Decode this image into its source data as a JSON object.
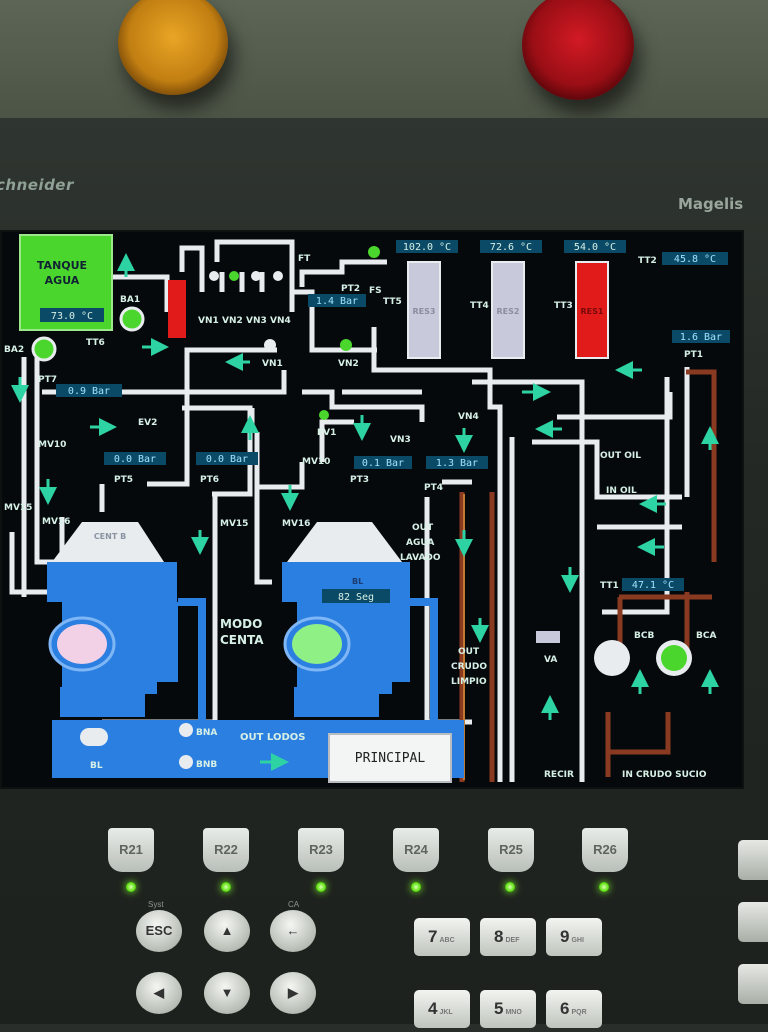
{
  "device": {
    "brand": "chneider",
    "model": "Magelis"
  },
  "tags": {
    "tank": [
      "TANQUE",
      "AGUA"
    ],
    "tank_temp": "73.0 °C",
    "ba1": "BA1",
    "ba2": "BA2",
    "tt6": "TT6",
    "pt7": "PT7",
    "pt7_val": "0.9 Bar",
    "vn1": "VN1",
    "vn2": "VN2",
    "vn3": "VN3",
    "vn4": "VN4",
    "ft": "FT",
    "pt2": "PT2",
    "pt2_val": "1.4 Bar",
    "fs": "FS",
    "tt5": "TT5",
    "res3_temp": "102.0 °C",
    "res2_temp": "72.6 °C",
    "res1_temp": "54.0 °C",
    "tt4": "TT4",
    "tt3": "TT3",
    "tt2": "TT2",
    "tt2_val": "45.8 °C",
    "pt1": "PT1",
    "pt1_val": "1.6 Bar",
    "res3": "RES3",
    "res2": "RES2",
    "res1": "RES1",
    "ev2": "EV2",
    "ev1": "EV1",
    "mv10": "MV10",
    "mv10b": "MV10",
    "pt5": "PT5",
    "pt5_val": "0.0 Bar",
    "pt6": "PT6",
    "pt6_val": "0.0 Bar",
    "pt3": "PT3",
    "pt3_val": "0.1 Bar",
    "pt4": "PT4",
    "pt4_val": "1.3 Bar",
    "mv15": "MV15",
    "mv16": "MV16",
    "mv15b": "MV15",
    "mv16b": "MV16",
    "cent_b": "CENT B",
    "bl_label": "BL",
    "timer": "82 Seg",
    "modo": [
      "MODO",
      "CENTA"
    ],
    "out_agua": [
      "OUT",
      "AGUA",
      "LAVADO"
    ],
    "out_crudo": [
      "OUT",
      "CRUDO",
      "LIMPIO"
    ],
    "out_oil": "OUT OIL",
    "in_oil": "IN OIL",
    "tt1": "TT1",
    "tt1_val": "47.1 °C",
    "bcb": "BCB",
    "bca": "BCA",
    "va": "VA",
    "bna": "BNA",
    "bnb": "BNB",
    "bl": "BL",
    "out_lodos": "OUT LODOS",
    "recir": "RECIR",
    "in_crudo_sucio": "IN CRUDO SUCIO",
    "principal": "PRINCIPAL"
  },
  "keys": {
    "function": [
      "R21",
      "R22",
      "R23",
      "R24",
      "R25",
      "R26"
    ],
    "esc": "ESC",
    "sys": "Syst",
    "ca": "CA",
    "num": [
      {
        "n": "7",
        "s": "ABC"
      },
      {
        "n": "8",
        "s": "DEF"
      },
      {
        "n": "9",
        "s": "GHI"
      },
      {
        "n": "4",
        "s": "JKL"
      },
      {
        "n": "5",
        "s": "MNO"
      },
      {
        "n": "6",
        "s": "PQR"
      }
    ]
  },
  "colors": {
    "pipe": "#e8ecef",
    "tank": "#4bd62e",
    "centrifuge": "#2b7fe0",
    "res_active": "#e11a1a",
    "text": "#d6f0e6",
    "arrow": "#2ed3a4",
    "value_bg": "#0b4a66"
  }
}
